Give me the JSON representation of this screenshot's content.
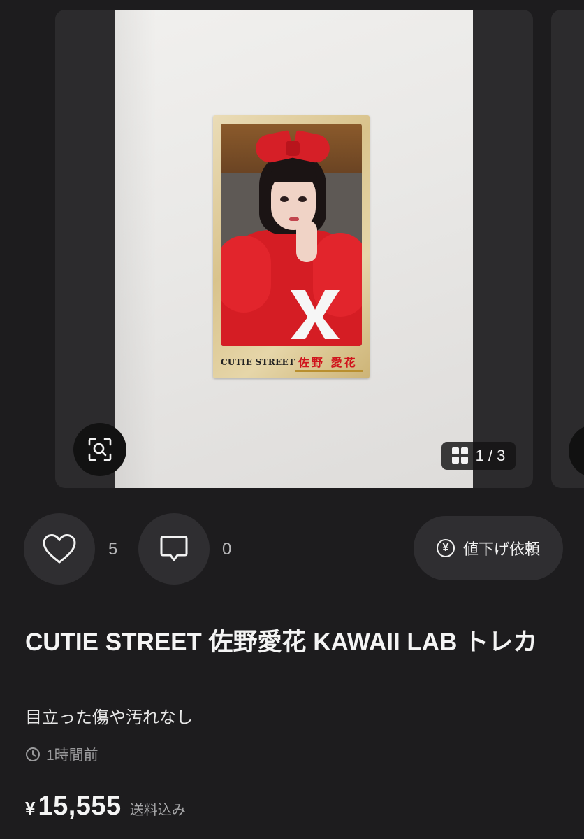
{
  "gallery": {
    "current_page": 1,
    "total_pages": 3,
    "page_indicator": "1 / 3",
    "card": {
      "logo_text": "CUTIE STREET",
      "name_text": "佐野 愛花"
    }
  },
  "actions": {
    "like_count": "5",
    "comment_count": "0",
    "price_request_label": "値下げ依頼"
  },
  "item": {
    "title": "CUTIE STREET 佐野愛花 KAWAII LAB トレカ",
    "condition": "目立った傷や汚れなし",
    "posted": "1時間前",
    "price_symbol": "¥",
    "price": "15,555",
    "shipping_note": "送料込み"
  },
  "colors": {
    "background": "#1d1c1e",
    "button_bg": "#2f2e31",
    "accent_red": "#d61f27"
  },
  "icons": {
    "zoom": "zoom-scan-icon",
    "grid": "grid-icon",
    "like": "heart-icon",
    "comment": "comment-icon",
    "price_request": "yen-circle-icon",
    "time": "clock-icon"
  }
}
